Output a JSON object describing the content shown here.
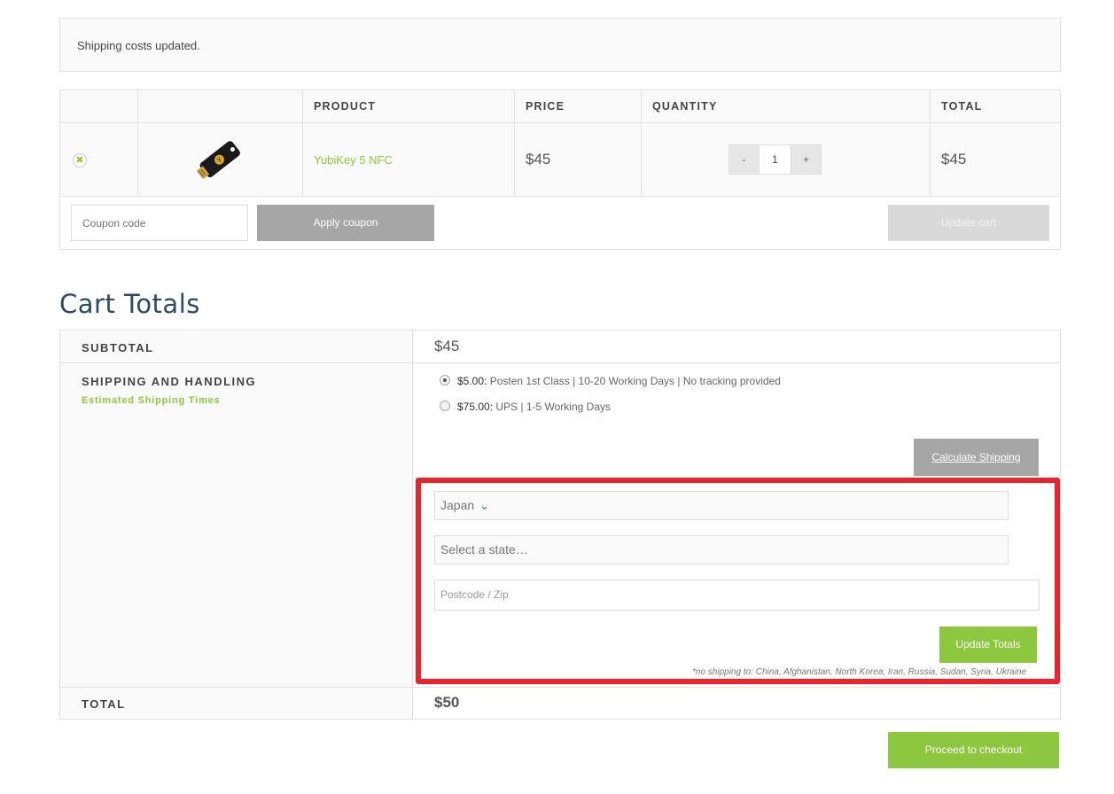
{
  "notice": {
    "message": "Shipping costs updated."
  },
  "cart": {
    "columns": [
      "",
      "",
      "PRODUCT",
      "PRICE",
      "QUANTITY",
      "TOTAL"
    ],
    "items": [
      {
        "name": "YubiKey 5 NFC",
        "price": "$45",
        "quantity": "1",
        "total": "$45"
      }
    ],
    "qty_minus": "-",
    "qty_plus": "+",
    "remove_glyph": "✖",
    "coupon_placeholder": "Coupon code",
    "apply_coupon_label": "Apply coupon",
    "update_cart_label": "Update cart"
  },
  "totals": {
    "title": "Cart Totals",
    "subtotal_label": "SUBTOTAL",
    "subtotal_value": "$45",
    "shipping_label": "SHIPPING AND HANDLING",
    "estimated_link": "Estimated Shipping Times",
    "options": [
      {
        "amount": "$5.00:",
        "description": "Posten 1st Class | 10-20 Working Days | No tracking provided",
        "selected": true
      },
      {
        "amount": "$75.00:",
        "description": "UPS | 1-5 Working Days",
        "selected": false
      }
    ],
    "calculate_shipping_label": "Calculate Shipping",
    "country_value": "Japan",
    "state_placeholder": "Select a state…",
    "postcode_placeholder": "Postcode / Zip",
    "update_totals_label": "Update Totals",
    "no_shipping_note": "*no shipping to: China, Afghanistan, North Korea, Iran, Russia, Sudan, Syria, Ukraine",
    "total_label": "TOTAL",
    "total_value": "$50"
  },
  "checkout_label": "Proceed to checkout",
  "colors": {
    "accent_green": "#8dc63f",
    "heading_blue": "#2d4a63",
    "highlight_red": "#e8242c",
    "button_gray": "#a6a6a6"
  }
}
